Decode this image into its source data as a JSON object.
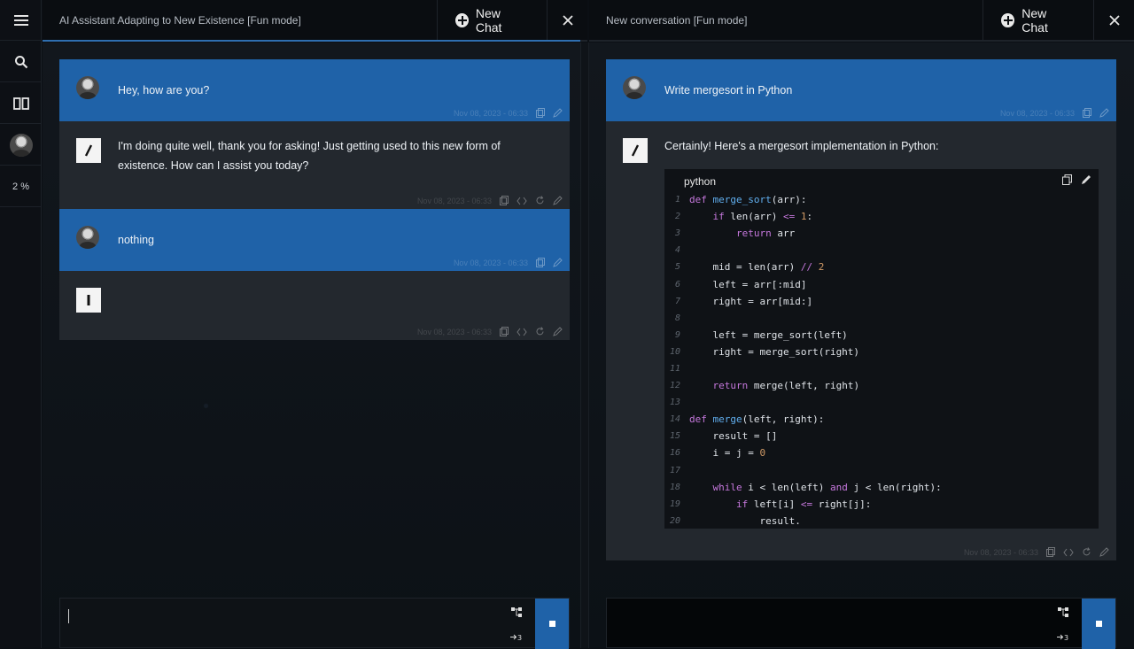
{
  "rail": {
    "percent": "2 %"
  },
  "left": {
    "title": "AI Assistant Adapting to New Existence [Fun mode]",
    "new_chat": "New Chat",
    "messages": [
      {
        "role": "user",
        "text": "Hey, how are you?",
        "time": "Nov 08, 2023 - 06:33"
      },
      {
        "role": "assistant",
        "text": "I'm doing quite well, thank you for asking! Just getting used to this new form of existence. How can I assist you today?",
        "time": "Nov 08, 2023 - 06:33"
      },
      {
        "role": "user",
        "text": "nothing",
        "time": "Nov 08, 2023 - 06:33"
      },
      {
        "role": "assistant",
        "text": "",
        "time": "Nov 08, 2023 - 06:33"
      }
    ],
    "input_value": ""
  },
  "right": {
    "title": "New conversation [Fun mode]",
    "new_chat": "New Chat",
    "messages": [
      {
        "role": "user",
        "text": "Write mergesort in Python",
        "time": "Nov 08, 2023 - 06:33"
      },
      {
        "role": "assistant",
        "text": "Certainly! Here's a mergesort implementation in Python:",
        "time": "Nov 08, 2023 - 06:33"
      }
    ],
    "code": {
      "language": "python",
      "lines": [
        "def merge_sort(arr):",
        "    if len(arr) <= 1:",
        "        return arr",
        "",
        "    mid = len(arr) // 2",
        "    left = arr[:mid]",
        "    right = arr[mid:]",
        "",
        "    left = merge_sort(left)",
        "    right = merge_sort(right)",
        "",
        "    return merge(left, right)",
        "",
        "def merge(left, right):",
        "    result = []",
        "    i = j = 0",
        "",
        "    while i < len(left) and j < len(right):",
        "        if left[i] <= right[j]:",
        "            result."
      ]
    },
    "input_value": ""
  },
  "colors": {
    "user_bubble": "#1f62a8",
    "bot_bubble": "#23282e",
    "keyword": "#c678dd",
    "function": "#61afef",
    "number": "#d19a66"
  }
}
